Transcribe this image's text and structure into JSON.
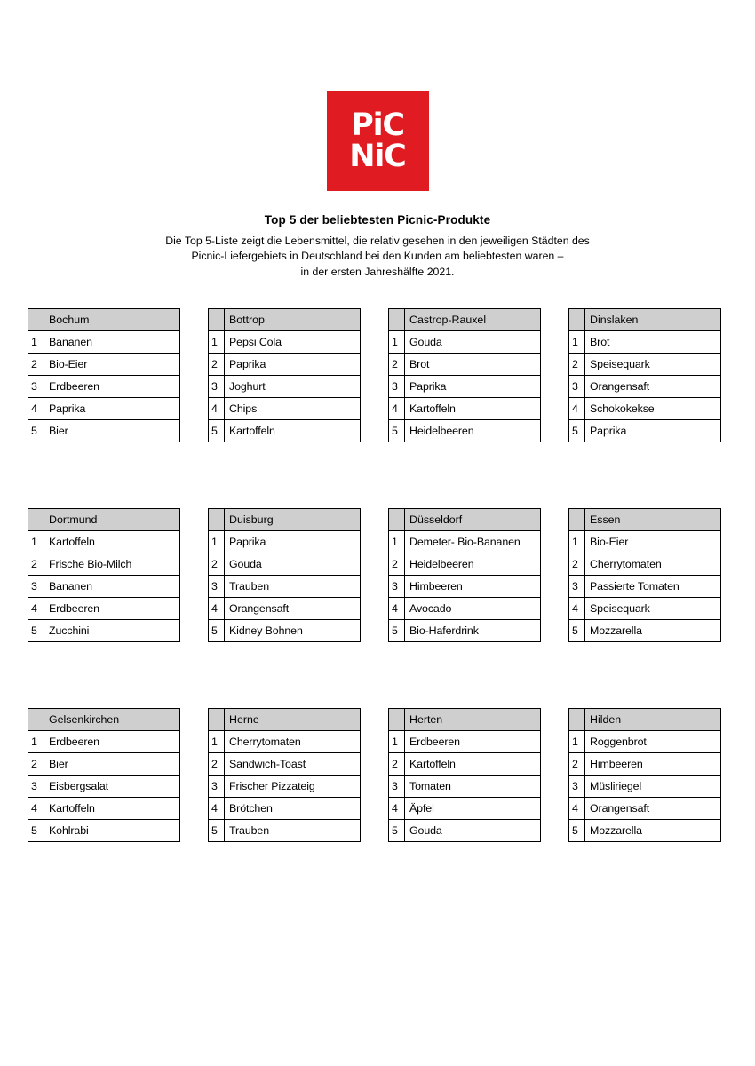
{
  "brand": {
    "logo_line1": "PiC",
    "logo_line2": "NiC",
    "red": "#e11b22"
  },
  "header": {
    "title": "Top 5 der beliebtesten Picnic-Produkte",
    "subtitle_line1": "Die Top 5-Liste zeigt die Lebensmittel, die relativ gesehen in den jeweiligen Städten des",
    "subtitle_line2": "Picnic-Liefergebiets in Deutschland bei den Kunden am beliebtesten waren –",
    "subtitle_line3": "in der ersten Jahreshälfte 2021."
  },
  "tables": [
    {
      "city": "Bochum",
      "rows": [
        {
          "rank": "1",
          "item": "Bananen"
        },
        {
          "rank": "2",
          "item": "Bio-Eier"
        },
        {
          "rank": "3",
          "item": "Erdbeeren"
        },
        {
          "rank": "4",
          "item": "Paprika"
        },
        {
          "rank": "5",
          "item": "Bier"
        }
      ]
    },
    {
      "city": "Bottrop",
      "rows": [
        {
          "rank": "1",
          "item": "Pepsi Cola"
        },
        {
          "rank": "2",
          "item": "Paprika"
        },
        {
          "rank": "3",
          "item": "Joghurt"
        },
        {
          "rank": "4",
          "item": "Chips"
        },
        {
          "rank": "5",
          "item": "Kartoffeln"
        }
      ]
    },
    {
      "city": "Castrop-Rauxel",
      "rows": [
        {
          "rank": "1",
          "item": "Gouda"
        },
        {
          "rank": "2",
          "item": "Brot"
        },
        {
          "rank": "3",
          "item": "Paprika"
        },
        {
          "rank": "4",
          "item": "Kartoffeln"
        },
        {
          "rank": "5",
          "item": "Heidelbeeren"
        }
      ]
    },
    {
      "city": "Dinslaken",
      "rows": [
        {
          "rank": "1",
          "item": "Brot"
        },
        {
          "rank": "2",
          "item": "Speisequark"
        },
        {
          "rank": "3",
          "item": "Orangensaft"
        },
        {
          "rank": "4",
          "item": "Schokokekse"
        },
        {
          "rank": "5",
          "item": "Paprika"
        }
      ]
    },
    {
      "city": "Dortmund",
      "rows": [
        {
          "rank": "1",
          "item": "Kartoffeln"
        },
        {
          "rank": "2",
          "item": "Frische Bio-Milch"
        },
        {
          "rank": "3",
          "item": "Bananen"
        },
        {
          "rank": "4",
          "item": "Erdbeeren"
        },
        {
          "rank": "5",
          "item": "Zucchini"
        }
      ]
    },
    {
      "city": "Duisburg",
      "rows": [
        {
          "rank": "1",
          "item": "Paprika"
        },
        {
          "rank": "2",
          "item": "Gouda"
        },
        {
          "rank": "3",
          "item": "Trauben"
        },
        {
          "rank": "4",
          "item": "Orangensaft"
        },
        {
          "rank": "5",
          "item": "Kidney Bohnen"
        }
      ]
    },
    {
      "city": "Düsseldorf",
      "rows": [
        {
          "rank": "1",
          "item": "Demeter- Bio-Bananen"
        },
        {
          "rank": "2",
          "item": "Heidelbeeren"
        },
        {
          "rank": "3",
          "item": "Himbeeren"
        },
        {
          "rank": "4",
          "item": "Avocado"
        },
        {
          "rank": "5",
          "item": "Bio-Haferdrink"
        }
      ]
    },
    {
      "city": "Essen",
      "rows": [
        {
          "rank": "1",
          "item": "Bio-Eier"
        },
        {
          "rank": "2",
          "item": "Cherrytomaten"
        },
        {
          "rank": "3",
          "item": "Passierte Tomaten"
        },
        {
          "rank": "4",
          "item": "Speisequark"
        },
        {
          "rank": "5",
          "item": "Mozzarella"
        }
      ]
    },
    {
      "city": "Gelsenkirchen",
      "rows": [
        {
          "rank": "1",
          "item": "Erdbeeren"
        },
        {
          "rank": "2",
          "item": "Bier"
        },
        {
          "rank": "3",
          "item": "Eisbergsalat"
        },
        {
          "rank": "4",
          "item": "Kartoffeln"
        },
        {
          "rank": "5",
          "item": "Kohlrabi"
        }
      ]
    },
    {
      "city": "Herne",
      "rows": [
        {
          "rank": "1",
          "item": "Cherrytomaten"
        },
        {
          "rank": "2",
          "item": "Sandwich-Toast"
        },
        {
          "rank": "3",
          "item": "Frischer Pizzateig"
        },
        {
          "rank": "4",
          "item": "Brötchen"
        },
        {
          "rank": "5",
          "item": "Trauben"
        }
      ]
    },
    {
      "city": "Herten",
      "rows": [
        {
          "rank": "1",
          "item": "Erdbeeren"
        },
        {
          "rank": "2",
          "item": "Kartoffeln"
        },
        {
          "rank": "3",
          "item": "Tomaten"
        },
        {
          "rank": "4",
          "item": "Äpfel"
        },
        {
          "rank": "5",
          "item": "Gouda"
        }
      ]
    },
    {
      "city": "Hilden",
      "rows": [
        {
          "rank": "1",
          "item": "Roggenbrot"
        },
        {
          "rank": "2",
          "item": "Himbeeren"
        },
        {
          "rank": "3",
          "item": "Müsliriegel"
        },
        {
          "rank": "4",
          "item": "Orangensaft"
        },
        {
          "rank": "5",
          "item": "Mozzarella"
        }
      ]
    }
  ]
}
